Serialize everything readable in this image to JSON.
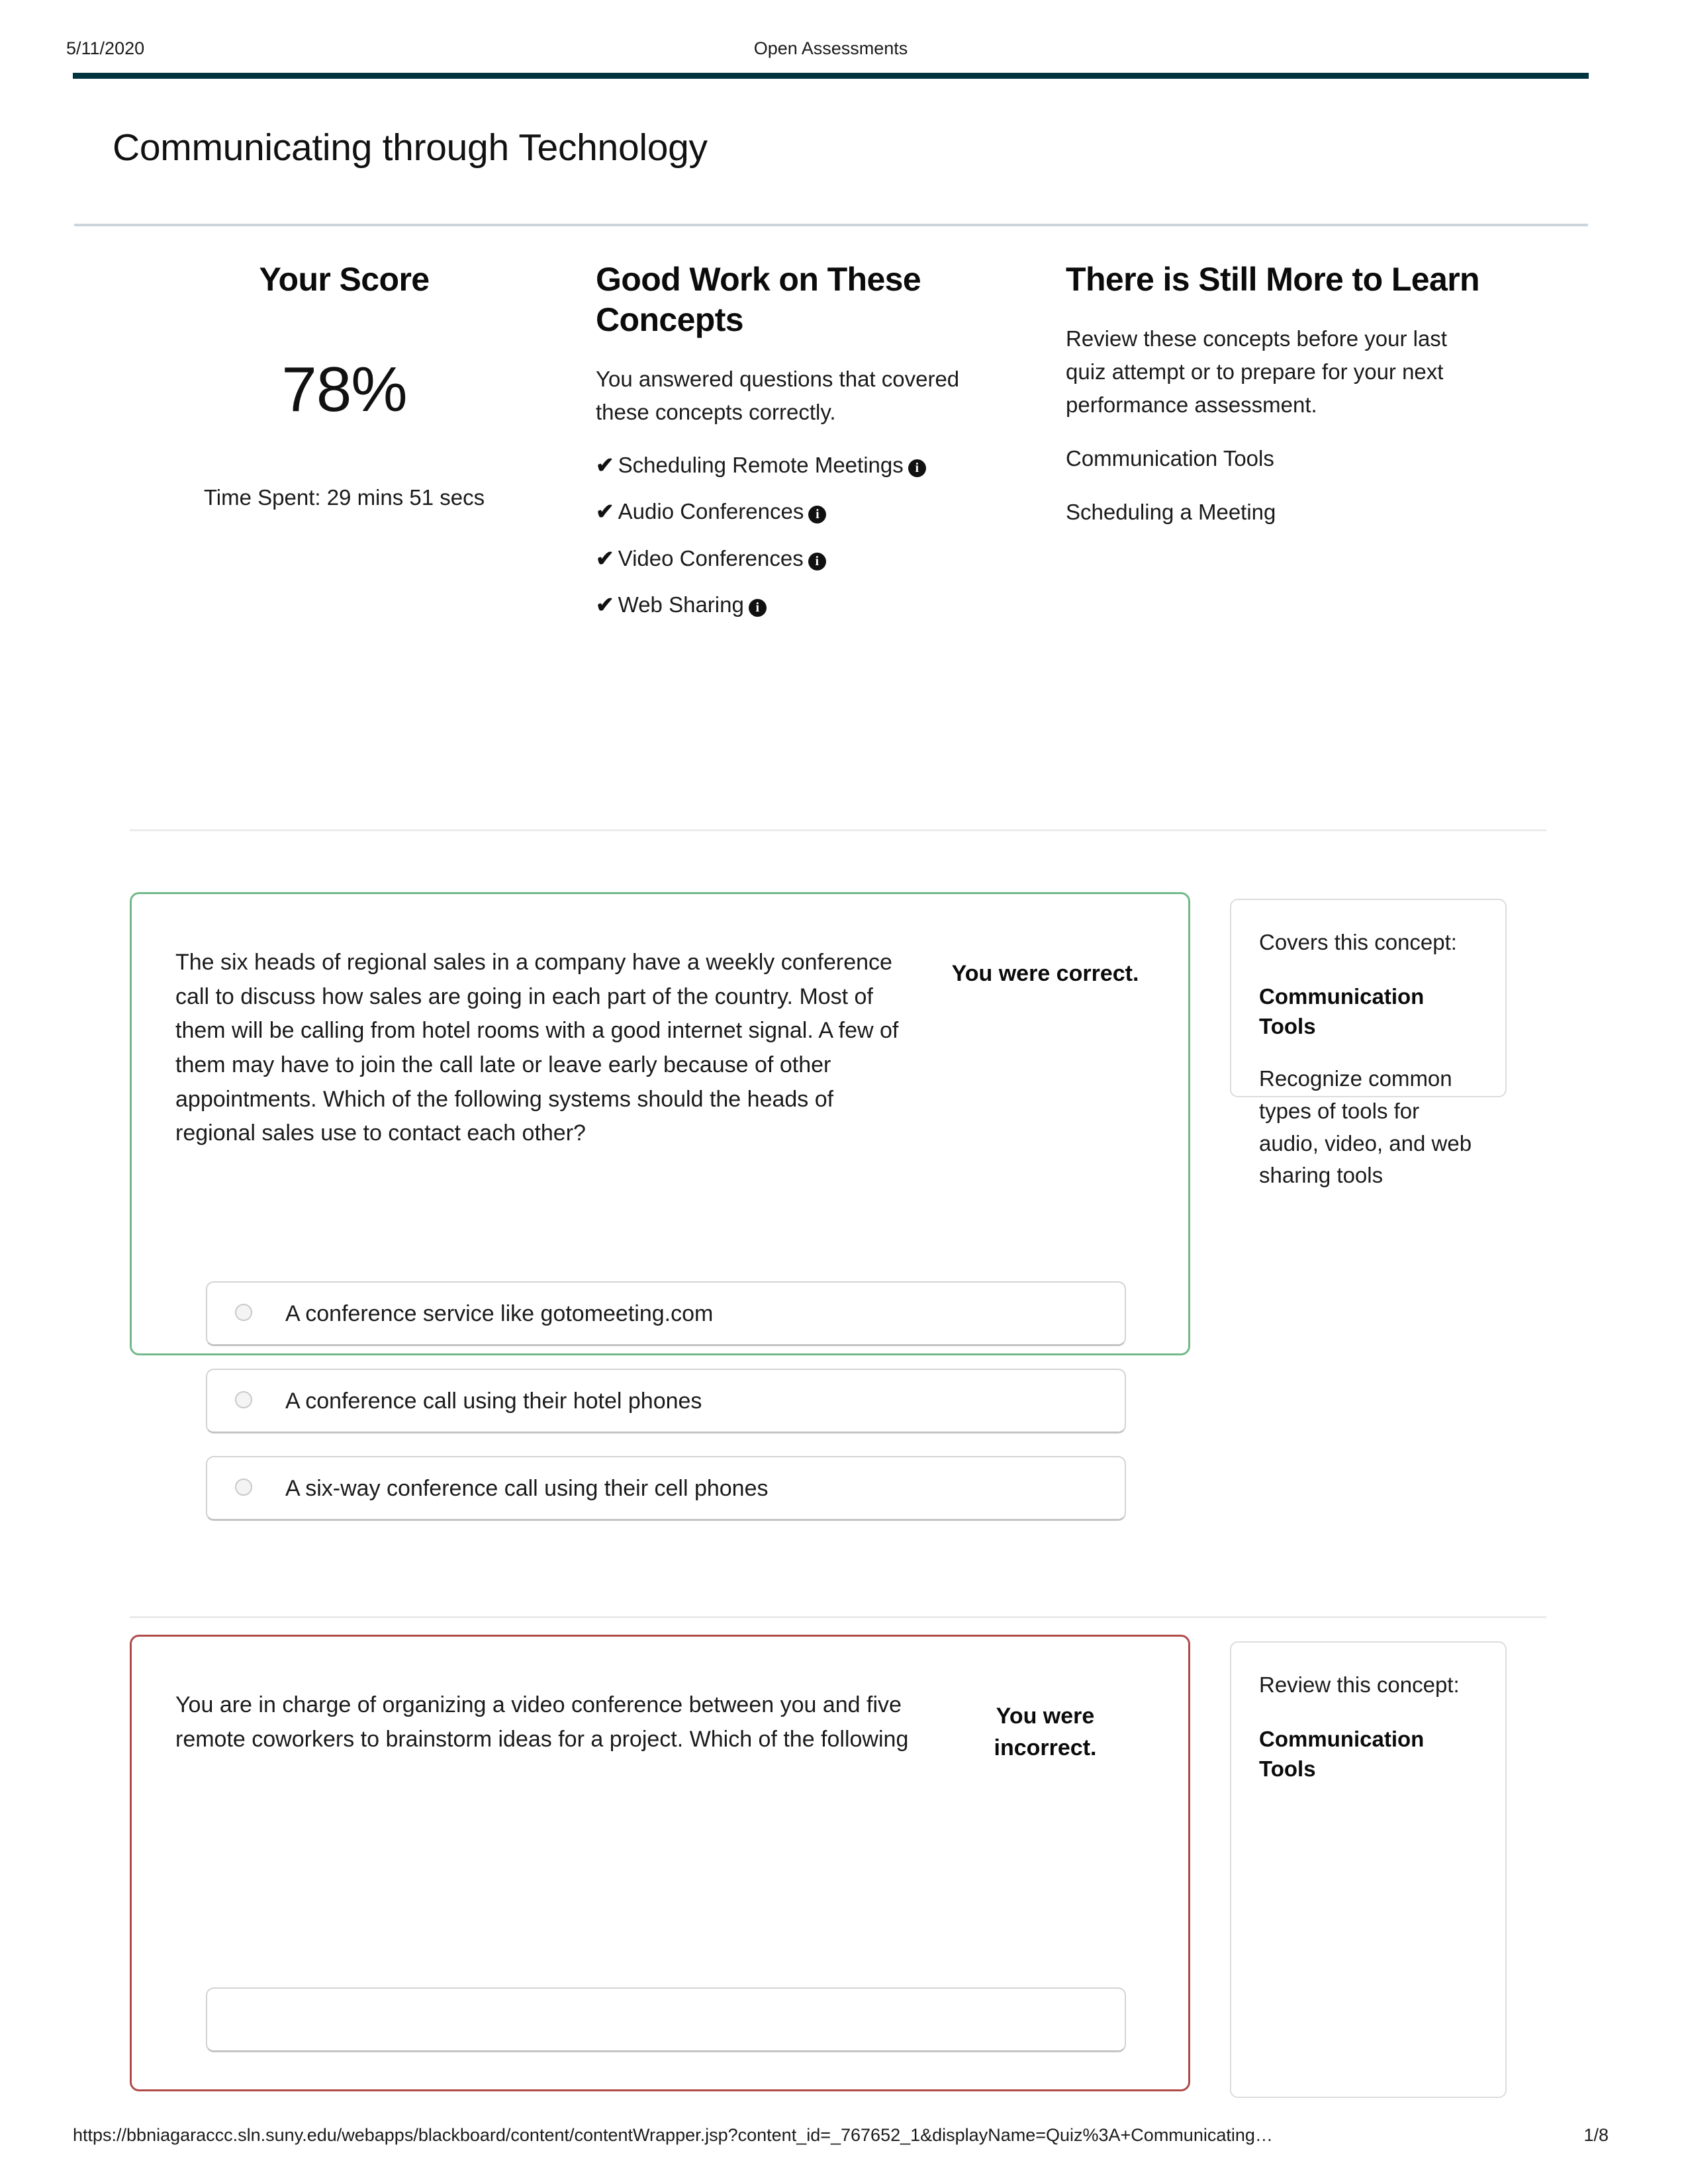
{
  "print_header": {
    "date": "5/11/2020",
    "title": "Open Assessments"
  },
  "page": {
    "title": "Communicating through Technology"
  },
  "summary": {
    "score": {
      "heading": "Your Score",
      "value": "78%",
      "time_spent": "Time Spent: 29 mins 51 secs"
    },
    "good_work": {
      "heading": "Good Work on These Concepts",
      "blurb": "You answered questions that covered these concepts correctly.",
      "items": [
        {
          "label": "Scheduling Remote Meetings",
          "check": "✔",
          "info": "i"
        },
        {
          "label": "Audio Conferences",
          "check": "✔",
          "info": "i"
        },
        {
          "label": "Video Conferences",
          "check": "✔",
          "info": "i"
        },
        {
          "label": "Web Sharing",
          "check": "✔",
          "info": "i"
        }
      ]
    },
    "more_to_learn": {
      "heading": "There is Still More to Learn",
      "blurb": "Review these concepts before your last quiz attempt or to prepare for your next performance assessment.",
      "items": [
        "Communication Tools",
        "Scheduling a Meeting"
      ]
    }
  },
  "questions": [
    {
      "status": "correct",
      "text": "The six heads of regional sales in a company have a weekly conference call to discuss how sales are going in each part of the country. Most of them will be calling from hotel rooms with a good internet signal. A few of them may have to join the call late or leave early because of other appointments. Which of the following systems should the heads of regional sales use to contact each other?",
      "verdict": "You were correct.",
      "options": [
        "A conference service like gotomeeting.com",
        "A conference call using their hotel phones",
        "A six-way conference call using their cell phones"
      ],
      "concept_card": {
        "lead": "Covers this concept:",
        "title": "Communication Tools",
        "description": "Recognize common types of tools for audio, video, and web sharing tools"
      }
    },
    {
      "status": "incorrect",
      "text": "You are in charge of organizing a video conference between you and five remote coworkers to brainstorm ideas for a project. Which of the following",
      "verdict": "You were incorrect.",
      "options": [
        ""
      ],
      "concept_card": {
        "lead": "Review this concept:",
        "title": "Communication Tools",
        "description": ""
      }
    }
  ],
  "print_footer": {
    "url": "https://bbniagaraccc.sln.suny.edu/webapps/blackboard/content/contentWrapper.jsp?content_id=_767652_1&displayName=Quiz%3A+Communicating…",
    "page_number": "1/8"
  },
  "colors": {
    "header_rule": "#00343f",
    "title_rule": "#ccd4dd",
    "correct_border": "#72b98a",
    "incorrect_border": "#b04a4a",
    "divider": "#ebebeb"
  }
}
